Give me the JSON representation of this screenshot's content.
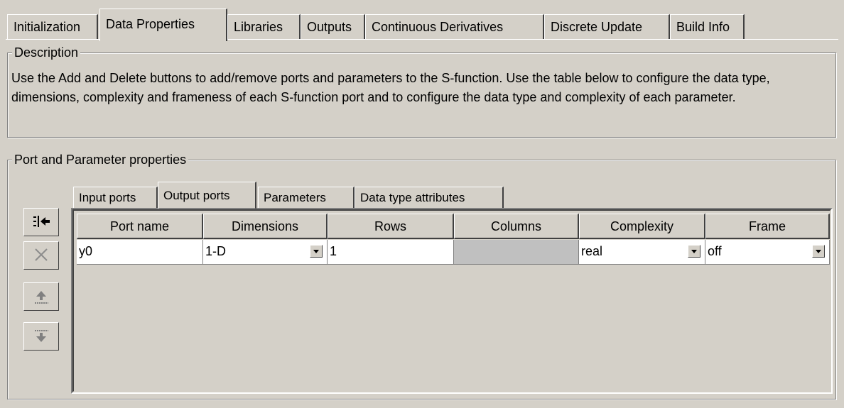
{
  "tabs": [
    {
      "label": "Initialization"
    },
    {
      "label": "Data Properties"
    },
    {
      "label": "Libraries"
    },
    {
      "label": "Outputs"
    },
    {
      "label": "Continuous Derivatives"
    },
    {
      "label": "Discrete Update"
    },
    {
      "label": "Build Info"
    }
  ],
  "active_tab": "Data Properties",
  "description": {
    "title": "Description",
    "text": "Use the Add and Delete buttons to add/remove ports and parameters to the S-function. Use the table below to configure the data type, dimensions, complexity and frameness of each S-function port and to configure the data type and complexity of each parameter."
  },
  "port_group": {
    "title": "Port and Parameter properties",
    "subtabs": [
      {
        "label": "Input ports"
      },
      {
        "label": "Output ports"
      },
      {
        "label": "Parameters"
      },
      {
        "label": "Data type attributes"
      }
    ],
    "active_subtab": "Output ports"
  },
  "side_buttons": [
    {
      "icon": "add-port-icon",
      "enabled": true
    },
    {
      "icon": "delete-icon",
      "enabled": false
    },
    {
      "icon": "move-up-icon",
      "enabled": false
    },
    {
      "icon": "move-down-icon",
      "enabled": false
    }
  ],
  "table": {
    "headers": [
      "Port name",
      "Dimensions",
      "Rows",
      "Columns",
      "Complexity",
      "Frame"
    ],
    "rows": [
      {
        "port_name": "y0",
        "dimensions": "1-D",
        "rows": "1",
        "columns": "",
        "complexity": "real",
        "frame": "off"
      }
    ]
  }
}
